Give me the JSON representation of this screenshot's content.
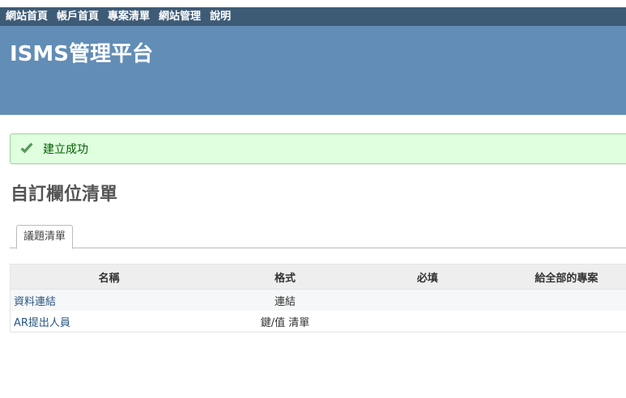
{
  "top_menu": {
    "items": [
      "網站首頁",
      "帳戶首頁",
      "專案清單",
      "網站管理",
      "說明"
    ]
  },
  "header": {
    "title": "ISMS管理平台"
  },
  "flash": {
    "icon": "check-icon",
    "message": "建立成功",
    "color": "#005f00"
  },
  "page": {
    "title": "自訂欄位清單"
  },
  "tabs": [
    {
      "label": "議題清單",
      "selected": true
    }
  ],
  "table": {
    "columns": [
      "名稱",
      "格式",
      "必填",
      "給全部的專案"
    ],
    "rows": [
      {
        "name": "資料連結",
        "format": "連結",
        "required": "",
        "for_all": ""
      },
      {
        "name": "AR提出人員",
        "format": "鍵/值 清單",
        "required": "",
        "for_all": ""
      }
    ]
  },
  "colors": {
    "top_menu_bg": "#3e5b76",
    "header_bg": "#628db6",
    "flash_bg": "#dfffdf",
    "link": "#2a5685"
  }
}
